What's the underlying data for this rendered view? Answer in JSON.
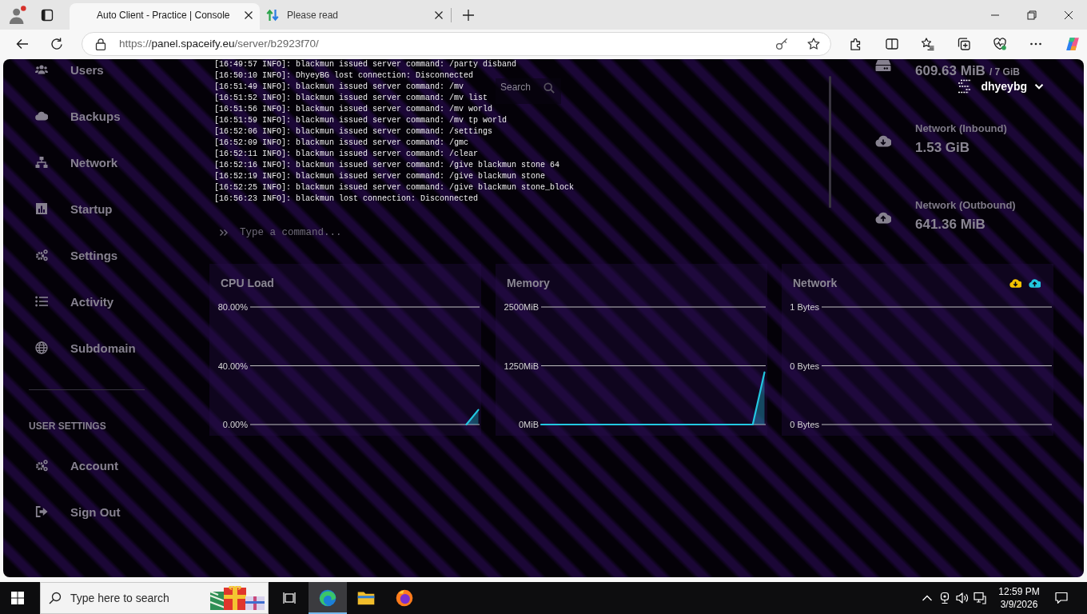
{
  "browser": {
    "tabs": [
      {
        "title": "Auto Client - Practice | Console",
        "selected": true
      },
      {
        "title": "Please read",
        "selected": false
      }
    ],
    "address": "https://panel.spaceify.eu/server/b2923f70/"
  },
  "sidebar": {
    "items": [
      {
        "label": "Users",
        "selected": false
      },
      {
        "label": "Backups",
        "selected": false
      },
      {
        "label": "Network",
        "selected": false
      },
      {
        "label": "Startup",
        "selected": false
      },
      {
        "label": "Settings",
        "selected": false
      },
      {
        "label": "Activity",
        "selected": false
      },
      {
        "label": "Subdomain",
        "selected": false
      }
    ],
    "section_title": "USER SETTINGS",
    "user_items": [
      {
        "label": "Account",
        "selected": false
      },
      {
        "label": "Sign Out",
        "selected": false
      }
    ]
  },
  "header": {
    "search": {
      "placeholder": "Search"
    },
    "user": {
      "name": "dhyeybg"
    }
  },
  "console": {
    "lines": [
      "[16:49:57 INFO]: blackmun issued server command: /party disband",
      "[16:50:10 INFO]: DhyeyBG lost connection: Disconnected",
      "[16:51:49 INFO]: blackmun issued server command: /mv",
      "[16:51:52 INFO]: blackmun issued server command: /mv list",
      "[16:51:56 INFO]: blackmun issued server command: /mv world",
      "[16:51:59 INFO]: blackmun issued server command: /mv tp world",
      "[16:52:06 INFO]: blackmun issued server command: /settings",
      "[16:52:09 INFO]: blackmun issued server command: /gmc",
      "[16:52:11 INFO]: blackmun issued server command: /clear",
      "[16:52:16 INFO]: blackmun issued server command: /give blackmun stone 64",
      "[16:52:19 INFO]: blackmun issued server command: /give blackmun stone",
      "[16:52:25 INFO]: blackmun issued server command: /give blackmun stone_block",
      "[16:56:23 INFO]: blackmun lost connection: Disconnected"
    ],
    "command": {
      "placeholder": "Type a command..."
    }
  },
  "stats": [
    {
      "kind": "disk",
      "value": "609.63 MiB",
      "limit": "/ 7 GiB"
    },
    {
      "kind": "inbound",
      "label": "Network (Inbound)",
      "value": "1.53 GiB"
    },
    {
      "kind": "outbound",
      "label": "Network (Outbound)",
      "value": "641.36 MiB"
    }
  ],
  "charts": [
    {
      "chart_data": {
        "type": "area",
        "title": "CPU Load",
        "ylim": [
          0,
          80
        ],
        "yticks": [
          {
            "value": 0,
            "label": "0.00%"
          },
          {
            "value": 40,
            "label": "40.00%"
          },
          {
            "value": 80,
            "label": "80.00%"
          }
        ],
        "series": [
          {
            "color": "#22c7e0",
            "values": [
              null,
              null,
              null,
              null,
              null,
              null,
              null,
              null,
              null,
              null,
              null,
              null,
              null,
              null,
              null,
              null,
              null,
              null,
              0,
              10
            ]
          }
        ]
      }
    },
    {
      "chart_data": {
        "type": "area",
        "title": "Memory",
        "ylim": [
          0,
          2500
        ],
        "yticks": [
          {
            "value": 0,
            "label": "0MiB"
          },
          {
            "value": 1250,
            "label": "1250MiB"
          },
          {
            "value": 2500,
            "label": "2500MiB"
          }
        ],
        "series": [
          {
            "color": "#22c7e0",
            "values": [
              0,
              0,
              0,
              0,
              0,
              0,
              0,
              0,
              0,
              0,
              0,
              0,
              0,
              0,
              0,
              0,
              0,
              0,
              0,
              1110
            ]
          }
        ]
      }
    },
    {
      "chart_data": {
        "type": "line",
        "title": "Network",
        "ylim": [
          0,
          1
        ],
        "yticks": [
          {
            "value": 0,
            "label": "0 Bytes"
          },
          {
            "value": 0.5,
            "label": "0 Bytes"
          },
          {
            "value": 1,
            "label": "1 Bytes"
          }
        ],
        "series": [
          {
            "color": "#f2c200",
            "values": [
              null,
              null,
              null,
              null,
              null,
              null,
              null,
              null,
              null,
              null,
              null,
              null,
              null,
              null,
              null,
              null,
              null,
              null,
              null,
              null
            ]
          },
          {
            "color": "#22c7e0",
            "values": [
              null,
              null,
              null,
              null,
              null,
              null,
              null,
              null,
              null,
              null,
              null,
              null,
              null,
              null,
              null,
              null,
              null,
              null,
              null,
              null
            ]
          }
        ]
      }
    }
  ],
  "taskbar": {
    "search": {
      "placeholder": "Type here to search"
    },
    "apps": [
      {
        "selected": true
      },
      {
        "selected": false
      },
      {
        "selected": false
      }
    ],
    "time": "12:59 PM",
    "date": "3/9/2026"
  }
}
